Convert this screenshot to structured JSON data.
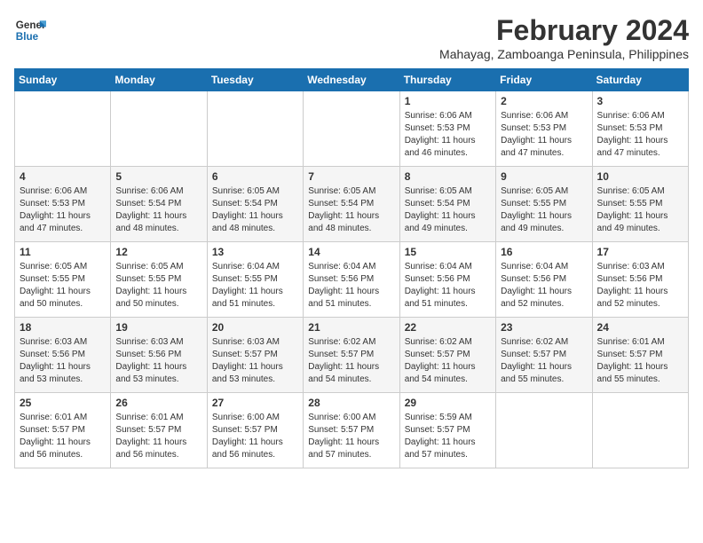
{
  "header": {
    "logo_line1": "General",
    "logo_line2": "Blue",
    "month_year": "February 2024",
    "location": "Mahayag, Zamboanga Peninsula, Philippines"
  },
  "days_of_week": [
    "Sunday",
    "Monday",
    "Tuesday",
    "Wednesday",
    "Thursday",
    "Friday",
    "Saturday"
  ],
  "weeks": [
    [
      {
        "day": "",
        "info": ""
      },
      {
        "day": "",
        "info": ""
      },
      {
        "day": "",
        "info": ""
      },
      {
        "day": "",
        "info": ""
      },
      {
        "day": "1",
        "info": "Sunrise: 6:06 AM\nSunset: 5:53 PM\nDaylight: 11 hours\nand 46 minutes."
      },
      {
        "day": "2",
        "info": "Sunrise: 6:06 AM\nSunset: 5:53 PM\nDaylight: 11 hours\nand 47 minutes."
      },
      {
        "day": "3",
        "info": "Sunrise: 6:06 AM\nSunset: 5:53 PM\nDaylight: 11 hours\nand 47 minutes."
      }
    ],
    [
      {
        "day": "4",
        "info": "Sunrise: 6:06 AM\nSunset: 5:53 PM\nDaylight: 11 hours\nand 47 minutes."
      },
      {
        "day": "5",
        "info": "Sunrise: 6:06 AM\nSunset: 5:54 PM\nDaylight: 11 hours\nand 48 minutes."
      },
      {
        "day": "6",
        "info": "Sunrise: 6:05 AM\nSunset: 5:54 PM\nDaylight: 11 hours\nand 48 minutes."
      },
      {
        "day": "7",
        "info": "Sunrise: 6:05 AM\nSunset: 5:54 PM\nDaylight: 11 hours\nand 48 minutes."
      },
      {
        "day": "8",
        "info": "Sunrise: 6:05 AM\nSunset: 5:54 PM\nDaylight: 11 hours\nand 49 minutes."
      },
      {
        "day": "9",
        "info": "Sunrise: 6:05 AM\nSunset: 5:55 PM\nDaylight: 11 hours\nand 49 minutes."
      },
      {
        "day": "10",
        "info": "Sunrise: 6:05 AM\nSunset: 5:55 PM\nDaylight: 11 hours\nand 49 minutes."
      }
    ],
    [
      {
        "day": "11",
        "info": "Sunrise: 6:05 AM\nSunset: 5:55 PM\nDaylight: 11 hours\nand 50 minutes."
      },
      {
        "day": "12",
        "info": "Sunrise: 6:05 AM\nSunset: 5:55 PM\nDaylight: 11 hours\nand 50 minutes."
      },
      {
        "day": "13",
        "info": "Sunrise: 6:04 AM\nSunset: 5:55 PM\nDaylight: 11 hours\nand 51 minutes."
      },
      {
        "day": "14",
        "info": "Sunrise: 6:04 AM\nSunset: 5:56 PM\nDaylight: 11 hours\nand 51 minutes."
      },
      {
        "day": "15",
        "info": "Sunrise: 6:04 AM\nSunset: 5:56 PM\nDaylight: 11 hours\nand 51 minutes."
      },
      {
        "day": "16",
        "info": "Sunrise: 6:04 AM\nSunset: 5:56 PM\nDaylight: 11 hours\nand 52 minutes."
      },
      {
        "day": "17",
        "info": "Sunrise: 6:03 AM\nSunset: 5:56 PM\nDaylight: 11 hours\nand 52 minutes."
      }
    ],
    [
      {
        "day": "18",
        "info": "Sunrise: 6:03 AM\nSunset: 5:56 PM\nDaylight: 11 hours\nand 53 minutes."
      },
      {
        "day": "19",
        "info": "Sunrise: 6:03 AM\nSunset: 5:56 PM\nDaylight: 11 hours\nand 53 minutes."
      },
      {
        "day": "20",
        "info": "Sunrise: 6:03 AM\nSunset: 5:57 PM\nDaylight: 11 hours\nand 53 minutes."
      },
      {
        "day": "21",
        "info": "Sunrise: 6:02 AM\nSunset: 5:57 PM\nDaylight: 11 hours\nand 54 minutes."
      },
      {
        "day": "22",
        "info": "Sunrise: 6:02 AM\nSunset: 5:57 PM\nDaylight: 11 hours\nand 54 minutes."
      },
      {
        "day": "23",
        "info": "Sunrise: 6:02 AM\nSunset: 5:57 PM\nDaylight: 11 hours\nand 55 minutes."
      },
      {
        "day": "24",
        "info": "Sunrise: 6:01 AM\nSunset: 5:57 PM\nDaylight: 11 hours\nand 55 minutes."
      }
    ],
    [
      {
        "day": "25",
        "info": "Sunrise: 6:01 AM\nSunset: 5:57 PM\nDaylight: 11 hours\nand 56 minutes."
      },
      {
        "day": "26",
        "info": "Sunrise: 6:01 AM\nSunset: 5:57 PM\nDaylight: 11 hours\nand 56 minutes."
      },
      {
        "day": "27",
        "info": "Sunrise: 6:00 AM\nSunset: 5:57 PM\nDaylight: 11 hours\nand 56 minutes."
      },
      {
        "day": "28",
        "info": "Sunrise: 6:00 AM\nSunset: 5:57 PM\nDaylight: 11 hours\nand 57 minutes."
      },
      {
        "day": "29",
        "info": "Sunrise: 5:59 AM\nSunset: 5:57 PM\nDaylight: 11 hours\nand 57 minutes."
      },
      {
        "day": "",
        "info": ""
      },
      {
        "day": "",
        "info": ""
      }
    ]
  ]
}
